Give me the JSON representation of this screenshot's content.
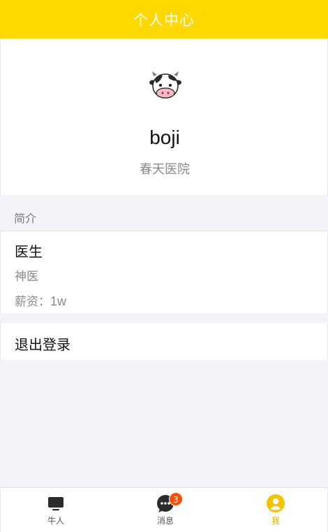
{
  "header": {
    "title": "个人中心"
  },
  "profile": {
    "avatar_icon": "cow-avatar-icon",
    "username": "boji",
    "hospital": "春天医院"
  },
  "intro": {
    "section_title": "简介",
    "role": "医生",
    "description": "神医",
    "salary_label": "薪资：",
    "salary_value": "1w"
  },
  "logout": {
    "label": "退出登录"
  },
  "tabbar": {
    "items": [
      {
        "label": "牛人",
        "icon": "monitor-icon"
      },
      {
        "label": "消息",
        "icon": "chat-bubble-icon",
        "badge": "3"
      },
      {
        "label": "我",
        "icon": "user-icon",
        "active": true
      }
    ]
  },
  "colors": {
    "accent": "#ffd800",
    "badge": "#ff4d00",
    "active_tab": "#e0b400"
  }
}
